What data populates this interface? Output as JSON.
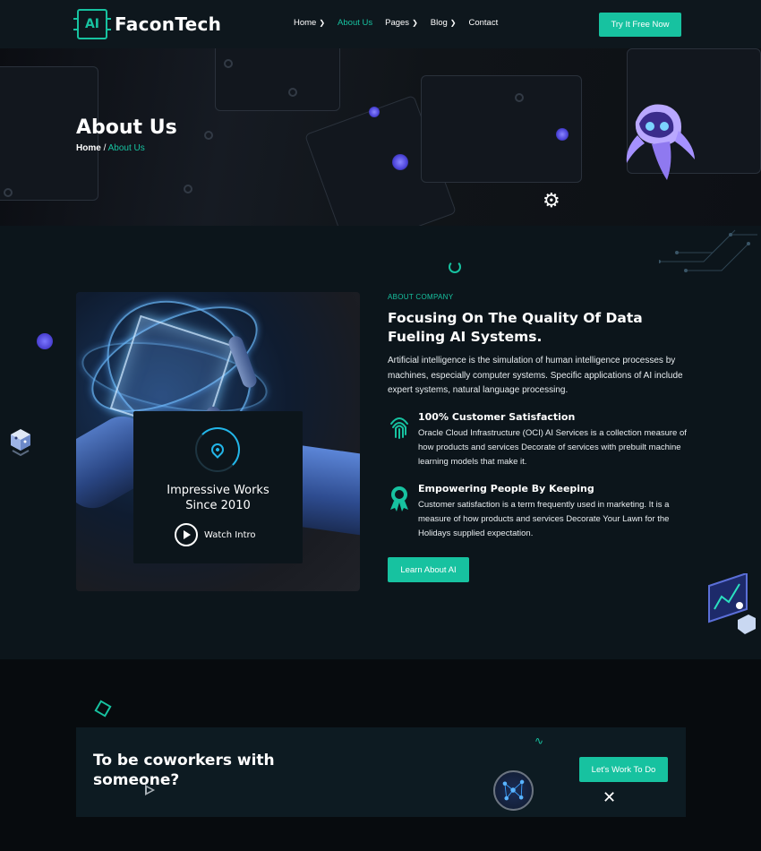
{
  "brand": {
    "logo_mark": "AI",
    "name": "FaconTech"
  },
  "nav": {
    "items": [
      {
        "label": "Home",
        "has_dropdown": true,
        "active": false
      },
      {
        "label": "About Us",
        "has_dropdown": false,
        "active": true
      },
      {
        "label": "Pages",
        "has_dropdown": true,
        "active": false
      },
      {
        "label": "Blog",
        "has_dropdown": true,
        "active": false
      },
      {
        "label": "Contact",
        "has_dropdown": false,
        "active": false
      }
    ],
    "cta_label": "Try It Free Now"
  },
  "hero": {
    "title": "About Us",
    "breadcrumb": {
      "home": "Home",
      "separator": " / ",
      "current": "About Us"
    },
    "icons": [
      "gear-icon",
      "robot-illustration"
    ]
  },
  "about": {
    "eyebrow": "ABOUT COMPANY",
    "title": "Focusing On The Quality Of Data Fueling AI Systems.",
    "description": "Artificial intelligence is the simulation of human intelligence processes by machines, especially computer systems. Specific applications of AI include expert systems, natural language processing.",
    "features": [
      {
        "icon": "fingerprint-icon",
        "title": "100% Customer Satisfaction",
        "text": "Oracle Cloud Infrastructure (OCI) AI Services is a collection measure of how products and services Decorate of services with prebuilt machine learning models that make it."
      },
      {
        "icon": "award-ribbon-icon",
        "title": "Empowering People By Keeping",
        "text": "Customer satisfaction is a term frequently used in marketing. It is a measure of how products and services Decorate Your Lawn for the Holidays supplied expectation."
      }
    ],
    "button_label": "Learn About AI",
    "works_card": {
      "icon": "location-pin-icon",
      "title_line1": "Impressive Works",
      "title_line2": "Since 2010",
      "watch_label": "Watch Intro"
    }
  },
  "cta": {
    "title_line1": "To be coworkers with",
    "title_line2": "someone?",
    "button_label": "Let's Work To Do",
    "close_symbol": "✕"
  },
  "colors": {
    "accent": "#17c2a0",
    "background": "#0c151b",
    "nav_background": "#0e171d",
    "cta_background": "#070b0e",
    "card_background": "#0d1b22",
    "orb": "#4b43d9",
    "pin": "#22b5e8"
  }
}
